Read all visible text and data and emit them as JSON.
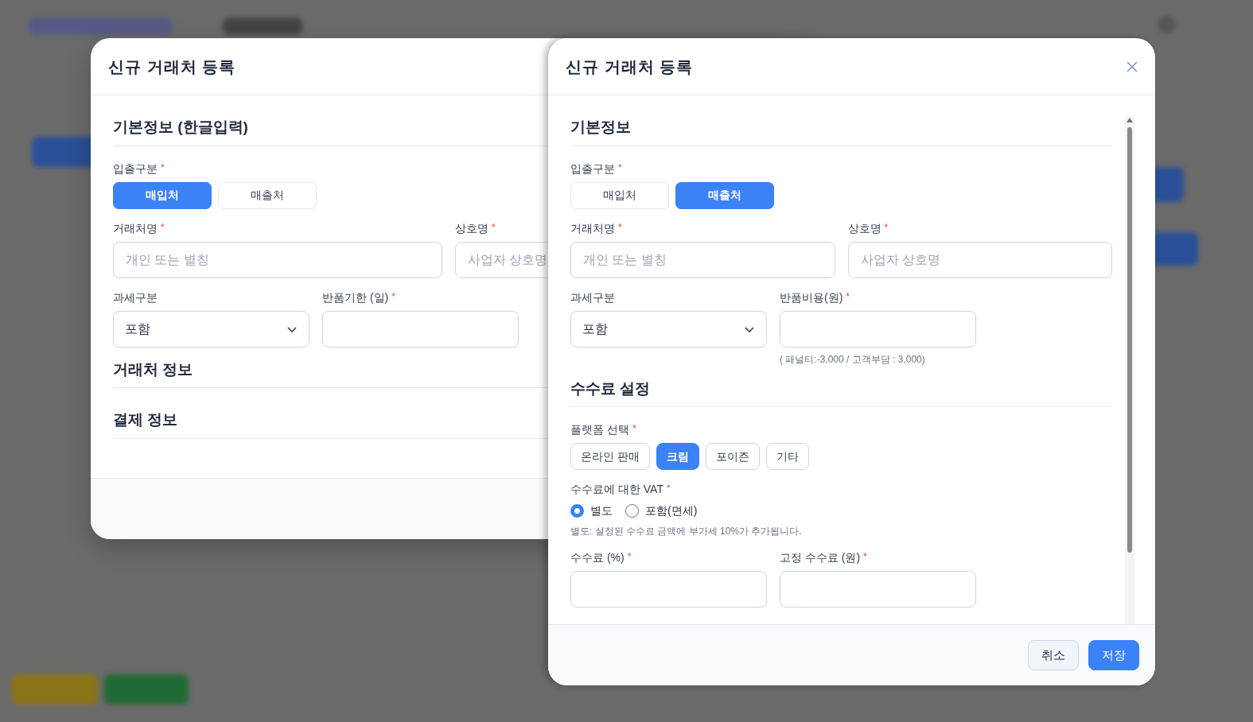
{
  "back_dialog": {
    "title": "신규 거래처 등록",
    "sections": [
      {
        "title": "기본정보 (한글입력)",
        "rows": [
          [
            {
              "kind": "segmented",
              "label": "입출구분",
              "marker": "*",
              "options": [
                {
                  "label": "매입처",
                  "selected": true
                },
                {
                  "label": "매출처",
                  "selected": false
                }
              ]
            }
          ],
          [
            {
              "kind": "text",
              "label": "거래처명",
              "marker": "*",
              "placeholder": "개인 또는 별칭"
            },
            {
              "kind": "text",
              "label": "상호명",
              "marker": "*",
              "placeholder": "사업자 상호명"
            }
          ],
          [
            {
              "kind": "select",
              "label": "과세구분",
              "value": "포함"
            },
            {
              "kind": "text",
              "label": "반품기한 (일)",
              "marker": "*"
            }
          ]
        ]
      },
      {
        "title": "거래처 정보"
      },
      {
        "title": "결제 정보"
      }
    ]
  },
  "front_dialog": {
    "title": "신규 거래처 등록",
    "sections": [
      {
        "title": "기본정보",
        "rows": [
          [
            {
              "kind": "segmented",
              "label": "입출구분",
              "marker": "*",
              "options": [
                {
                  "label": "매입처",
                  "selected": false
                },
                {
                  "label": "매출처",
                  "selected": true
                }
              ]
            }
          ],
          [
            {
              "kind": "text",
              "label": "거래처명",
              "marker": "*",
              "placeholder": "개인 또는 별칭"
            },
            {
              "kind": "text",
              "label": "상호명",
              "marker": "*",
              "placeholder": "사업자 상호명"
            }
          ],
          [
            {
              "kind": "select",
              "label": "과세구분",
              "value": "포함"
            },
            {
              "kind": "text",
              "label": "반품비용(원)",
              "marker": "*",
              "help": "( 패널티:-3,000 / 고객부담 : 3,000)"
            }
          ]
        ]
      },
      {
        "title": "수수료 설정",
        "rows": [
          [
            {
              "kind": "chips",
              "label": "플랫폼 선택",
              "marker": "*",
              "options": [
                {
                  "label": "온라인 판매",
                  "selected": false
                },
                {
                  "label": "크림",
                  "selected": true
                },
                {
                  "label": "포이즌",
                  "selected": false
                },
                {
                  "label": "기타",
                  "selected": false
                }
              ]
            }
          ],
          [
            {
              "kind": "radio",
              "label": "수수료에 대한 VAT",
              "marker": "*",
              "options": [
                {
                  "label": "별도",
                  "selected": true
                },
                {
                  "label": "포함(면세)",
                  "selected": false
                }
              ],
              "help": "별도: 설정된 수수료 금액에 부가세 10%가 추가됩니다."
            }
          ],
          [
            {
              "kind": "text",
              "label": "수수료 (%)",
              "marker": "*"
            },
            {
              "kind": "text",
              "label": "고정 수수료 (원)",
              "marker": "*"
            }
          ]
        ]
      }
    ],
    "buttons": [
      {
        "label": "취소",
        "kind": "secondary"
      },
      {
        "label": "저장",
        "kind": "primary"
      }
    ]
  }
}
